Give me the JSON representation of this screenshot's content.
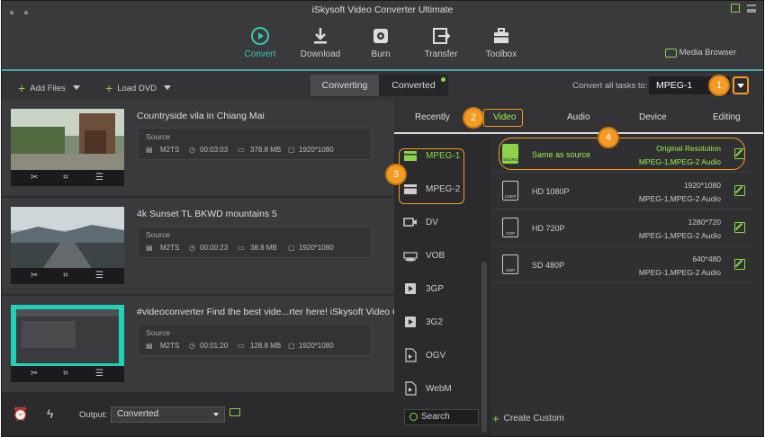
{
  "window": {
    "title": "iSkysoft Video Converter Ultimate"
  },
  "toolbar": {
    "tools": [
      {
        "label": "Convert",
        "icon": "convert-icon",
        "active": true
      },
      {
        "label": "Download",
        "icon": "download-icon"
      },
      {
        "label": "Burn",
        "icon": "burn-icon"
      },
      {
        "label": "Transfer",
        "icon": "transfer-icon"
      },
      {
        "label": "Toolbox",
        "icon": "toolbox-icon"
      }
    ],
    "media_browser": "Media Browser"
  },
  "subbar": {
    "add_files": "Add Files",
    "load_dvd": "Load DVD",
    "seg_converting": "Converting",
    "seg_converted": "Converted",
    "convert_all_label": "Convert all tasks to:",
    "convert_all_value": "MPEG-1"
  },
  "badges": [
    "1",
    "2",
    "3",
    "4"
  ],
  "videos": [
    {
      "title": "Countryside vila in Chiang Mai",
      "source_label": "Source",
      "format": "M2TS",
      "duration": "00:03:03",
      "size": "378.8 MB",
      "resolution": "1920*1080"
    },
    {
      "title": "4k Sunset TL BKWD mountains 5",
      "source_label": "Source",
      "format": "M2TS",
      "duration": "00:00:23",
      "size": "38.8 MB",
      "resolution": "1920*1080"
    },
    {
      "title": "#videoconverter Find the best vide...rter here!  iSkysoft Video Cor",
      "source_label": "Source",
      "format": "M2TS",
      "duration": "00:01:20",
      "size": "128.8 MB",
      "resolution": "1920*1080"
    }
  ],
  "footer": {
    "output_label": "Output:",
    "output_value": "Converted"
  },
  "panel": {
    "tabs": [
      "Recently",
      "Video",
      "Audio",
      "Device",
      "Editing"
    ],
    "categories": [
      "MPEG-1",
      "MPEG-2",
      "DV",
      "VOB",
      "3GP",
      "3G2",
      "OGV",
      "WebM"
    ],
    "resolutions": [
      {
        "name": "Same as source",
        "line1": "Original Resolution",
        "line2": "MPEG-1,MPEG-2 Audio",
        "icon_text": "SOURCE"
      },
      {
        "name": "HD 1080P",
        "line1": "1920*1080",
        "line2": "MPEG-1,MPEG-2 Audio",
        "icon_text": "1080P"
      },
      {
        "name": "HD 720P",
        "line1": "1280*720",
        "line2": "MPEG-1,MPEG-2 Audio",
        "icon_text": "720P"
      },
      {
        "name": "SD 480P",
        "line1": "640*480",
        "line2": "MPEG-1,MPEG-2 Audio",
        "icon_text": "480P"
      }
    ],
    "search": "Search",
    "create_custom": "Create Custom"
  },
  "colors": {
    "accent_green": "#8bd44a",
    "teal": "#3ac7b2",
    "callout_orange": "#f59a23"
  }
}
